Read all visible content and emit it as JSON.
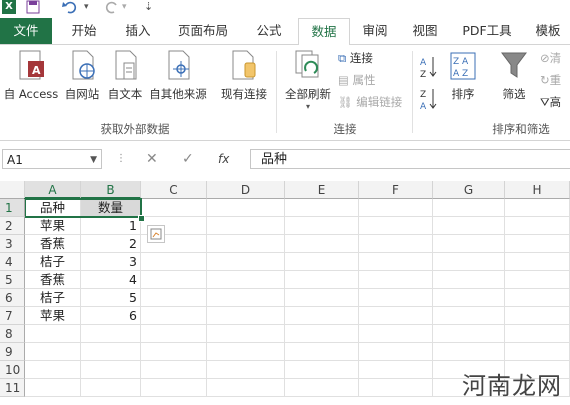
{
  "app": {
    "icon_label": "X"
  },
  "quick_access": {
    "save_icon": "save-icon",
    "undo_icon": "undo-icon",
    "redo_icon": "redo-icon"
  },
  "tabs": [
    {
      "label": "文件"
    },
    {
      "label": "开始"
    },
    {
      "label": "插入"
    },
    {
      "label": "页面布局"
    },
    {
      "label": "公式"
    },
    {
      "label": "数据"
    },
    {
      "label": "审阅"
    },
    {
      "label": "视图"
    },
    {
      "label": "PDF工具"
    },
    {
      "label": "模板"
    }
  ],
  "ribbon": {
    "external": {
      "from_access": "自 Access",
      "from_web": "自网站",
      "from_text": "自文本",
      "from_other": "自其他来源",
      "existing": "现有连接",
      "group_label": "获取外部数据"
    },
    "connections": {
      "refresh_all": "全部刷新",
      "connections": "连接",
      "properties": "属性",
      "edit_links": "编辑链接",
      "group_label": "连接"
    },
    "sort_filter": {
      "sort": "排序",
      "filter": "筛选",
      "clear": "清",
      "reapply": "重",
      "advanced": "高",
      "group_label": "排序和筛选"
    }
  },
  "formula_bar": {
    "name_box": "A1",
    "fx": "fx",
    "content": "品种"
  },
  "columns": [
    "A",
    "B",
    "C",
    "D",
    "E",
    "F",
    "G",
    "H"
  ],
  "rows": [
    "1",
    "2",
    "3",
    "4",
    "5",
    "6",
    "7",
    "8",
    "9",
    "10",
    "11"
  ],
  "cells": {
    "header": [
      "品种",
      "数量"
    ],
    "data": [
      [
        "苹果",
        "1"
      ],
      [
        "香蕉",
        "2"
      ],
      [
        "桔子",
        "3"
      ],
      [
        "香蕉",
        "4"
      ],
      [
        "桔子",
        "5"
      ],
      [
        "苹果",
        "6"
      ]
    ]
  },
  "watermark": "河南龙网",
  "colors": {
    "accent": "#217346",
    "header_bg": "#f3f3f3"
  }
}
